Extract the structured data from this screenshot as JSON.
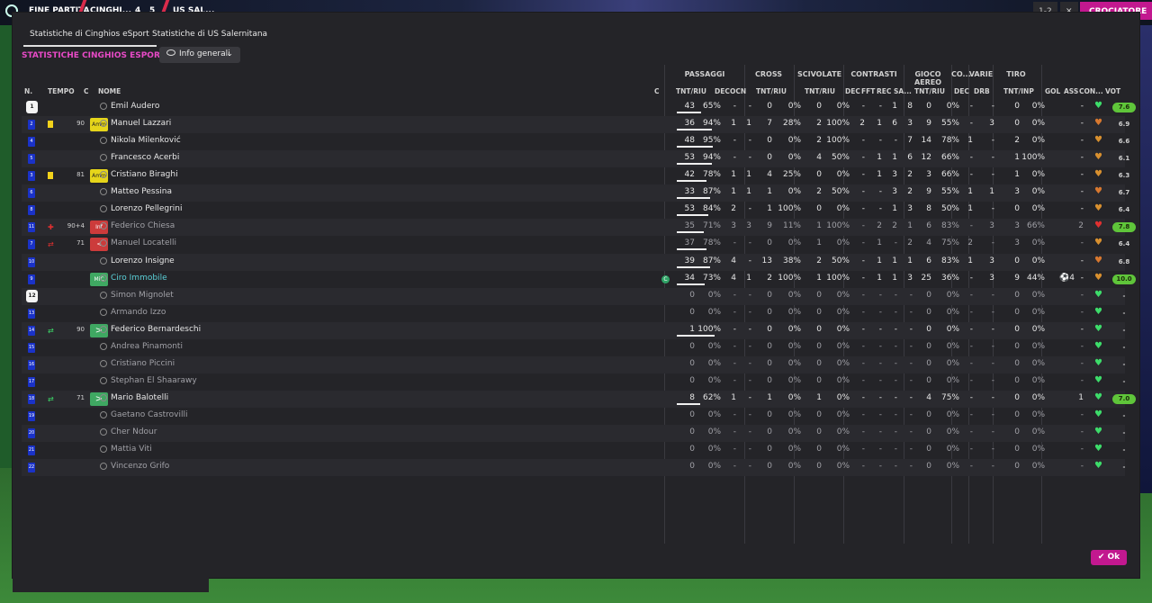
{
  "topbar": {
    "status": "FINE PARTITA",
    "home": "CINGHI...",
    "score_home": "4",
    "score_away": "5",
    "away": "US SAL...",
    "right_score": "1-2",
    "right_x": "✕",
    "button": "CROCIATORE"
  },
  "tabs": [
    "Statistiche di Cinghios eSport",
    "Statistiche di US Salernitana"
  ],
  "section_title": "STATISTICHE CINGHIOS ESPORT",
  "dropdown": {
    "label": "Info generali"
  },
  "groups": [
    "PASSAGGI",
    "CROSS",
    "SCIVOLATE",
    "CONTRASTI",
    "GIOCO AEREO",
    "CO...",
    "VARIE",
    "TIRO"
  ],
  "headers": {
    "n": "N.",
    "tempo": "TEMPO",
    "c": "C",
    "nome": "NOME",
    "c2": "C",
    "pass_tnt": "TNT/RIU",
    "pass_dec": "DEC",
    "pass_ocn": "OCN",
    "cross_tnt": "TNT/RIU",
    "sciv_tnt": "TNT/RIU",
    "contr_dec": "DEC",
    "contr_fft": "FFT",
    "contr_rec": "REC SA...",
    "aereo_tnt": "TNT/RIU",
    "co_dec": "DEC",
    "varie_drb": "DRB",
    "tiro_tnt": "TNT/INP",
    "gol": "GOL",
    "ass": "ASS",
    "con": "CON...",
    "vot": "VOT"
  },
  "players": [
    {
      "num": "1",
      "shirt": true,
      "name": "Emil Audero",
      "p": [
        "43",
        "65%"
      ],
      "pd": "-",
      "po": "-",
      "cr": [
        "0",
        "0%"
      ],
      "sc": [
        "0",
        "0%"
      ],
      "cd": "-",
      "cf": "-",
      "crs": [
        "1",
        "8"
      ],
      "ae": [
        "0",
        "0%"
      ],
      "co": "-",
      "dr": "-",
      "ti": [
        "0",
        "0%"
      ],
      "gol": "",
      "ass": "-",
      "heart": "#3ddc6a",
      "vot": "7.6",
      "votc": "#5fc53a",
      "dim": false,
      "bar": 0.65
    },
    {
      "num": "2",
      "yc": true,
      "min": "90",
      "badge": "Amm",
      "name": "Manuel Lazzari",
      "p": [
        "36",
        "94%"
      ],
      "pd": "1",
      "po": "1",
      "cr": [
        "7",
        "28%"
      ],
      "sc": [
        "2",
        "100%"
      ],
      "cd": "2",
      "cf": "1",
      "crs": [
        "6",
        "3"
      ],
      "ae": [
        "9",
        "55%"
      ],
      "co": "-",
      "dr": "3",
      "ti": [
        "0",
        "0%"
      ],
      "gol": "",
      "ass": "-",
      "heart": "#d8782f",
      "vot": "6.9",
      "votc": "",
      "dim": false,
      "bar": 0.94
    },
    {
      "num": "4",
      "name": "Nikola Milenković",
      "p": [
        "48",
        "95%"
      ],
      "pd": "-",
      "po": "-",
      "cr": [
        "0",
        "0%"
      ],
      "sc": [
        "2",
        "100%"
      ],
      "cd": "-",
      "cf": "-",
      "crs": [
        "-",
        "7"
      ],
      "ae": [
        "14",
        "78%"
      ],
      "co": "1",
      "dr": "-",
      "ti": [
        "2",
        "0%"
      ],
      "gol": "",
      "ass": "-",
      "heart": "#d8902f",
      "vot": "6.6",
      "votc": "",
      "dim": false,
      "bar": 0.95
    },
    {
      "num": "5",
      "name": "Francesco Acerbi",
      "p": [
        "53",
        "94%"
      ],
      "pd": "-",
      "po": "-",
      "cr": [
        "0",
        "0%"
      ],
      "sc": [
        "4",
        "50%"
      ],
      "cd": "-",
      "cf": "1",
      "crs": [
        "1",
        "6"
      ],
      "ae": [
        "12",
        "66%"
      ],
      "co": "-",
      "dr": "-",
      "ti": [
        "1",
        "100%"
      ],
      "gol": "",
      "ass": "-",
      "heart": "#d8902f",
      "vot": "6.1",
      "votc": "",
      "dim": false,
      "bar": 0.94
    },
    {
      "num": "3",
      "yc": true,
      "min": "81",
      "badge": "Amm",
      "name": "Cristiano Biraghi",
      "p": [
        "42",
        "78%"
      ],
      "pd": "1",
      "po": "1",
      "cr": [
        "4",
        "25%"
      ],
      "sc": [
        "0",
        "0%"
      ],
      "cd": "-",
      "cf": "1",
      "crs": [
        "3",
        "2"
      ],
      "ae": [
        "3",
        "66%"
      ],
      "co": "-",
      "dr": "-",
      "ti": [
        "1",
        "0%"
      ],
      "gol": "",
      "ass": "-",
      "heart": "#d8902f",
      "vot": "6.3",
      "votc": "",
      "dim": false,
      "bar": 0.78
    },
    {
      "num": "6",
      "name": "Matteo Pessina",
      "p": [
        "33",
        "87%"
      ],
      "pd": "1",
      "po": "1",
      "cr": [
        "1",
        "0%"
      ],
      "sc": [
        "2",
        "50%"
      ],
      "cd": "-",
      "cf": "-",
      "crs": [
        "3",
        "2"
      ],
      "ae": [
        "9",
        "55%"
      ],
      "co": "1",
      "dr": "1",
      "ti": [
        "3",
        "0%"
      ],
      "gol": "",
      "ass": "-",
      "heart": "#d8782f",
      "vot": "6.7",
      "votc": "",
      "dim": false,
      "bar": 0.87
    },
    {
      "num": "8",
      "name": "Lorenzo Pellegrini",
      "p": [
        "53",
        "84%"
      ],
      "pd": "2",
      "po": "-",
      "cr": [
        "1",
        "100%"
      ],
      "sc": [
        "0",
        "0%"
      ],
      "cd": "-",
      "cf": "-",
      "crs": [
        "1",
        "3"
      ],
      "ae": [
        "8",
        "50%"
      ],
      "co": "1",
      "dr": "-",
      "ti": [
        "0",
        "0%"
      ],
      "gol": "",
      "ass": "-",
      "heart": "#d8902f",
      "vot": "6.4",
      "votc": "",
      "dim": false,
      "bar": 0.84
    },
    {
      "num": "11",
      "injury": true,
      "min": "90+4",
      "badge": "Inf",
      "name": "Federico Chiesa",
      "p": [
        "35",
        "71%"
      ],
      "pd": "3",
      "po": "3",
      "cr": [
        "9",
        "11%"
      ],
      "sc": [
        "1",
        "100%"
      ],
      "cd": "-",
      "cf": "2",
      "crs": [
        "2",
        "1"
      ],
      "ae": [
        "6",
        "83%"
      ],
      "co": "-",
      "dr": "3",
      "ti": [
        "3",
        "66%"
      ],
      "gol": "",
      "ass": "2",
      "heart": "#e03030",
      "vot": "7.8",
      "votc": "#5fc53a",
      "dim": true,
      "bar": 0.71
    },
    {
      "num": "7",
      "subout": true,
      "min": "71",
      "badge": "<",
      "name": "Manuel Locatelli",
      "p": [
        "37",
        "78%"
      ],
      "pd": "-",
      "po": "-",
      "cr": [
        "0",
        "0%"
      ],
      "sc": [
        "1",
        "0%"
      ],
      "cd": "-",
      "cf": "1",
      "crs": [
        "-",
        "2"
      ],
      "ae": [
        "4",
        "75%"
      ],
      "co": "2",
      "dr": "-",
      "ti": [
        "3",
        "0%"
      ],
      "gol": "",
      "ass": "-",
      "heart": "#d8902f",
      "vot": "6.4",
      "votc": "",
      "dim": true,
      "bar": 0.78
    },
    {
      "num": "10",
      "name": "Lorenzo Insigne",
      "p": [
        "39",
        "87%"
      ],
      "pd": "4",
      "po": "-",
      "cr": [
        "13",
        "38%"
      ],
      "sc": [
        "2",
        "50%"
      ],
      "cd": "-",
      "cf": "1",
      "crs": [
        "1",
        "1"
      ],
      "ae": [
        "6",
        "83%"
      ],
      "co": "1",
      "dr": "3",
      "ti": [
        "0",
        "0%"
      ],
      "gol": "",
      "ass": "-",
      "heart": "#d8782f",
      "vot": "6.8",
      "votc": "",
      "dim": false,
      "bar": 0.87
    },
    {
      "num": "9",
      "badge": "MiC",
      "name": "Ciro Immobile",
      "cmark": true,
      "p": [
        "34",
        "73%"
      ],
      "pd": "4",
      "po": "1",
      "cr": [
        "2",
        "100%"
      ],
      "sc": [
        "1",
        "100%"
      ],
      "cd": "-",
      "cf": "1",
      "crs": [
        "1",
        "3"
      ],
      "ae": [
        "25",
        "36%"
      ],
      "co": "-",
      "dr": "3",
      "ti": [
        "9",
        "44%"
      ],
      "gol": "⚽4",
      "ass": "-",
      "heart": "#d8902f",
      "vot": "10.0",
      "votc": "#5fc53a",
      "dim": false,
      "hl": true,
      "bar": 0.73
    },
    {
      "num": "12",
      "shirt": true,
      "name": "Simon Mignolet",
      "p": [
        "0",
        "0%"
      ],
      "pd": "-",
      "po": "-",
      "cr": [
        "0",
        "0%"
      ],
      "sc": [
        "0",
        "0%"
      ],
      "cd": "-",
      "cf": "-",
      "crs": [
        "-",
        "-"
      ],
      "ae": [
        "0",
        "0%"
      ],
      "co": "-",
      "dr": "-",
      "ti": [
        "0",
        "0%"
      ],
      "gol": "",
      "ass": "-",
      "heart": "#3ddc6a",
      "vot": "-",
      "votc": "",
      "dim": true,
      "bar": 0
    },
    {
      "num": "13",
      "name": "Armando Izzo",
      "p": [
        "0",
        "0%"
      ],
      "pd": "-",
      "po": "-",
      "cr": [
        "0",
        "0%"
      ],
      "sc": [
        "0",
        "0%"
      ],
      "cd": "-",
      "cf": "-",
      "crs": [
        "-",
        "-"
      ],
      "ae": [
        "0",
        "0%"
      ],
      "co": "-",
      "dr": "-",
      "ti": [
        "0",
        "0%"
      ],
      "gol": "",
      "ass": "-",
      "heart": "#3ddc6a",
      "vot": "-",
      "votc": "",
      "dim": true,
      "bar": 0
    },
    {
      "num": "14",
      "subin": true,
      "min": "90",
      "badge": ">",
      "name": "Federico Bernardeschi",
      "p": [
        "1",
        "100%"
      ],
      "pd": "-",
      "po": "-",
      "cr": [
        "0",
        "0%"
      ],
      "sc": [
        "0",
        "0%"
      ],
      "cd": "-",
      "cf": "-",
      "crs": [
        "-",
        "-"
      ],
      "ae": [
        "0",
        "0%"
      ],
      "co": "-",
      "dr": "-",
      "ti": [
        "0",
        "0%"
      ],
      "gol": "",
      "ass": "-",
      "heart": "#3ddc6a",
      "vot": "-",
      "votc": "",
      "dim": false,
      "bar": 1.0
    },
    {
      "num": "15",
      "name": "Andrea Pinamonti",
      "p": [
        "0",
        "0%"
      ],
      "pd": "-",
      "po": "-",
      "cr": [
        "0",
        "0%"
      ],
      "sc": [
        "0",
        "0%"
      ],
      "cd": "-",
      "cf": "-",
      "crs": [
        "-",
        "-"
      ],
      "ae": [
        "0",
        "0%"
      ],
      "co": "-",
      "dr": "-",
      "ti": [
        "0",
        "0%"
      ],
      "gol": "",
      "ass": "-",
      "heart": "#3ddc6a",
      "vot": "-",
      "votc": "",
      "dim": true,
      "bar": 0
    },
    {
      "num": "16",
      "name": "Cristiano Piccini",
      "p": [
        "0",
        "0%"
      ],
      "pd": "-",
      "po": "-",
      "cr": [
        "0",
        "0%"
      ],
      "sc": [
        "0",
        "0%"
      ],
      "cd": "-",
      "cf": "-",
      "crs": [
        "-",
        "-"
      ],
      "ae": [
        "0",
        "0%"
      ],
      "co": "-",
      "dr": "-",
      "ti": [
        "0",
        "0%"
      ],
      "gol": "",
      "ass": "-",
      "heart": "#3ddc6a",
      "vot": "-",
      "votc": "",
      "dim": true,
      "bar": 0
    },
    {
      "num": "17",
      "name": "Stephan El Shaarawy",
      "p": [
        "0",
        "0%"
      ],
      "pd": "-",
      "po": "-",
      "cr": [
        "0",
        "0%"
      ],
      "sc": [
        "0",
        "0%"
      ],
      "cd": "-",
      "cf": "-",
      "crs": [
        "-",
        "-"
      ],
      "ae": [
        "0",
        "0%"
      ],
      "co": "-",
      "dr": "-",
      "ti": [
        "0",
        "0%"
      ],
      "gol": "",
      "ass": "-",
      "heart": "#3ddc6a",
      "vot": "-",
      "votc": "",
      "dim": true,
      "bar": 0
    },
    {
      "num": "18",
      "subin": true,
      "min": "71",
      "badge": ">",
      "name": "Mario Balotelli",
      "p": [
        "8",
        "62%"
      ],
      "pd": "1",
      "po": "-",
      "cr": [
        "1",
        "0%"
      ],
      "sc": [
        "1",
        "0%"
      ],
      "cd": "-",
      "cf": "-",
      "crs": [
        "-",
        "-"
      ],
      "ae": [
        "4",
        "75%"
      ],
      "co": "-",
      "dr": "-",
      "ti": [
        "0",
        "0%"
      ],
      "gol": "",
      "ass": "1",
      "heart": "#3ddc6a",
      "vot": "7.0",
      "votc": "#5fc53a",
      "dim": false,
      "bar": 0.62
    },
    {
      "num": "19",
      "name": "Gaetano Castrovilli",
      "p": [
        "0",
        "0%"
      ],
      "pd": "-",
      "po": "-",
      "cr": [
        "0",
        "0%"
      ],
      "sc": [
        "0",
        "0%"
      ],
      "cd": "-",
      "cf": "-",
      "crs": [
        "-",
        "-"
      ],
      "ae": [
        "0",
        "0%"
      ],
      "co": "-",
      "dr": "-",
      "ti": [
        "0",
        "0%"
      ],
      "gol": "",
      "ass": "-",
      "heart": "#3ddc6a",
      "vot": "-",
      "votc": "",
      "dim": true,
      "bar": 0
    },
    {
      "num": "20",
      "name": "Cher Ndour",
      "p": [
        "0",
        "0%"
      ],
      "pd": "-",
      "po": "-",
      "cr": [
        "0",
        "0%"
      ],
      "sc": [
        "0",
        "0%"
      ],
      "cd": "-",
      "cf": "-",
      "crs": [
        "-",
        "-"
      ],
      "ae": [
        "0",
        "0%"
      ],
      "co": "-",
      "dr": "-",
      "ti": [
        "0",
        "0%"
      ],
      "gol": "",
      "ass": "-",
      "heart": "#3ddc6a",
      "vot": "-",
      "votc": "",
      "dim": true,
      "bar": 0
    },
    {
      "num": "21",
      "name": "Mattia Viti",
      "p": [
        "0",
        "0%"
      ],
      "pd": "-",
      "po": "-",
      "cr": [
        "0",
        "0%"
      ],
      "sc": [
        "0",
        "0%"
      ],
      "cd": "-",
      "cf": "-",
      "crs": [
        "-",
        "-"
      ],
      "ae": [
        "0",
        "0%"
      ],
      "co": "-",
      "dr": "-",
      "ti": [
        "0",
        "0%"
      ],
      "gol": "",
      "ass": "-",
      "heart": "#3ddc6a",
      "vot": "-",
      "votc": "",
      "dim": true,
      "bar": 0
    },
    {
      "num": "22",
      "name": "Vincenzo Grifo",
      "p": [
        "0",
        "0%"
      ],
      "pd": "-",
      "po": "-",
      "cr": [
        "0",
        "0%"
      ],
      "sc": [
        "0",
        "0%"
      ],
      "cd": "-",
      "cf": "-",
      "crs": [
        "-",
        "-"
      ],
      "ae": [
        "0",
        "0%"
      ],
      "co": "-",
      "dr": "-",
      "ti": [
        "0",
        "0%"
      ],
      "gol": "",
      "ass": "-",
      "heart": "#3ddc6a",
      "vot": "-",
      "votc": "",
      "dim": true,
      "bar": 0
    }
  ],
  "ok_button": "Ok",
  "colors": {
    "accent": "#c2188f",
    "title": "#e84ac7",
    "kit": "#1a32c8",
    "yellow_card": "#f2d21b"
  }
}
